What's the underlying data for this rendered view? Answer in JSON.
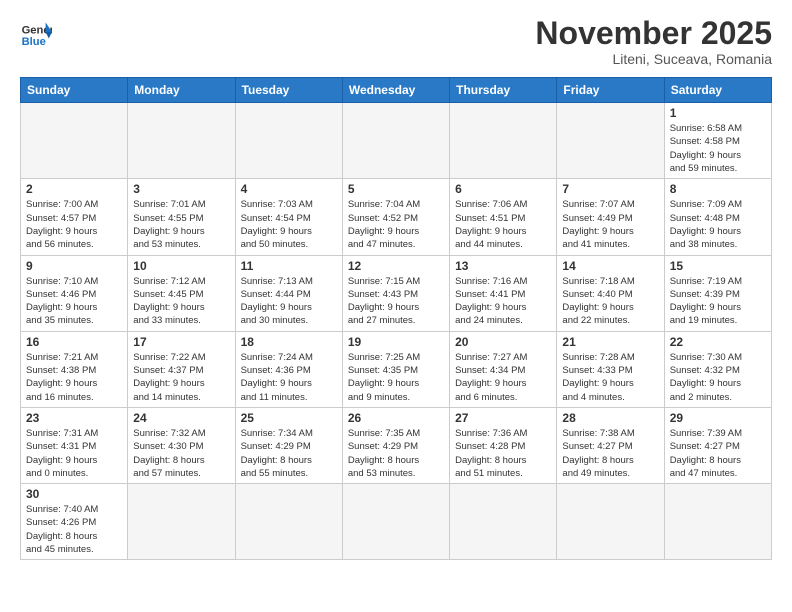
{
  "logo": {
    "text_general": "General",
    "text_blue": "Blue"
  },
  "header": {
    "month_year": "November 2025",
    "location": "Liteni, Suceava, Romania"
  },
  "weekdays": [
    "Sunday",
    "Monday",
    "Tuesday",
    "Wednesday",
    "Thursday",
    "Friday",
    "Saturday"
  ],
  "weeks": [
    [
      {
        "day": "",
        "info": ""
      },
      {
        "day": "",
        "info": ""
      },
      {
        "day": "",
        "info": ""
      },
      {
        "day": "",
        "info": ""
      },
      {
        "day": "",
        "info": ""
      },
      {
        "day": "",
        "info": ""
      },
      {
        "day": "1",
        "info": "Sunrise: 6:58 AM\nSunset: 4:58 PM\nDaylight: 9 hours\nand 59 minutes."
      }
    ],
    [
      {
        "day": "2",
        "info": "Sunrise: 7:00 AM\nSunset: 4:57 PM\nDaylight: 9 hours\nand 56 minutes."
      },
      {
        "day": "3",
        "info": "Sunrise: 7:01 AM\nSunset: 4:55 PM\nDaylight: 9 hours\nand 53 minutes."
      },
      {
        "day": "4",
        "info": "Sunrise: 7:03 AM\nSunset: 4:54 PM\nDaylight: 9 hours\nand 50 minutes."
      },
      {
        "day": "5",
        "info": "Sunrise: 7:04 AM\nSunset: 4:52 PM\nDaylight: 9 hours\nand 47 minutes."
      },
      {
        "day": "6",
        "info": "Sunrise: 7:06 AM\nSunset: 4:51 PM\nDaylight: 9 hours\nand 44 minutes."
      },
      {
        "day": "7",
        "info": "Sunrise: 7:07 AM\nSunset: 4:49 PM\nDaylight: 9 hours\nand 41 minutes."
      },
      {
        "day": "8",
        "info": "Sunrise: 7:09 AM\nSunset: 4:48 PM\nDaylight: 9 hours\nand 38 minutes."
      }
    ],
    [
      {
        "day": "9",
        "info": "Sunrise: 7:10 AM\nSunset: 4:46 PM\nDaylight: 9 hours\nand 35 minutes."
      },
      {
        "day": "10",
        "info": "Sunrise: 7:12 AM\nSunset: 4:45 PM\nDaylight: 9 hours\nand 33 minutes."
      },
      {
        "day": "11",
        "info": "Sunrise: 7:13 AM\nSunset: 4:44 PM\nDaylight: 9 hours\nand 30 minutes."
      },
      {
        "day": "12",
        "info": "Sunrise: 7:15 AM\nSunset: 4:43 PM\nDaylight: 9 hours\nand 27 minutes."
      },
      {
        "day": "13",
        "info": "Sunrise: 7:16 AM\nSunset: 4:41 PM\nDaylight: 9 hours\nand 24 minutes."
      },
      {
        "day": "14",
        "info": "Sunrise: 7:18 AM\nSunset: 4:40 PM\nDaylight: 9 hours\nand 22 minutes."
      },
      {
        "day": "15",
        "info": "Sunrise: 7:19 AM\nSunset: 4:39 PM\nDaylight: 9 hours\nand 19 minutes."
      }
    ],
    [
      {
        "day": "16",
        "info": "Sunrise: 7:21 AM\nSunset: 4:38 PM\nDaylight: 9 hours\nand 16 minutes."
      },
      {
        "day": "17",
        "info": "Sunrise: 7:22 AM\nSunset: 4:37 PM\nDaylight: 9 hours\nand 14 minutes."
      },
      {
        "day": "18",
        "info": "Sunrise: 7:24 AM\nSunset: 4:36 PM\nDaylight: 9 hours\nand 11 minutes."
      },
      {
        "day": "19",
        "info": "Sunrise: 7:25 AM\nSunset: 4:35 PM\nDaylight: 9 hours\nand 9 minutes."
      },
      {
        "day": "20",
        "info": "Sunrise: 7:27 AM\nSunset: 4:34 PM\nDaylight: 9 hours\nand 6 minutes."
      },
      {
        "day": "21",
        "info": "Sunrise: 7:28 AM\nSunset: 4:33 PM\nDaylight: 9 hours\nand 4 minutes."
      },
      {
        "day": "22",
        "info": "Sunrise: 7:30 AM\nSunset: 4:32 PM\nDaylight: 9 hours\nand 2 minutes."
      }
    ],
    [
      {
        "day": "23",
        "info": "Sunrise: 7:31 AM\nSunset: 4:31 PM\nDaylight: 9 hours\nand 0 minutes."
      },
      {
        "day": "24",
        "info": "Sunrise: 7:32 AM\nSunset: 4:30 PM\nDaylight: 8 hours\nand 57 minutes."
      },
      {
        "day": "25",
        "info": "Sunrise: 7:34 AM\nSunset: 4:29 PM\nDaylight: 8 hours\nand 55 minutes."
      },
      {
        "day": "26",
        "info": "Sunrise: 7:35 AM\nSunset: 4:29 PM\nDaylight: 8 hours\nand 53 minutes."
      },
      {
        "day": "27",
        "info": "Sunrise: 7:36 AM\nSunset: 4:28 PM\nDaylight: 8 hours\nand 51 minutes."
      },
      {
        "day": "28",
        "info": "Sunrise: 7:38 AM\nSunset: 4:27 PM\nDaylight: 8 hours\nand 49 minutes."
      },
      {
        "day": "29",
        "info": "Sunrise: 7:39 AM\nSunset: 4:27 PM\nDaylight: 8 hours\nand 47 minutes."
      }
    ],
    [
      {
        "day": "30",
        "info": "Sunrise: 7:40 AM\nSunset: 4:26 PM\nDaylight: 8 hours\nand 45 minutes."
      },
      {
        "day": "",
        "info": ""
      },
      {
        "day": "",
        "info": ""
      },
      {
        "day": "",
        "info": ""
      },
      {
        "day": "",
        "info": ""
      },
      {
        "day": "",
        "info": ""
      },
      {
        "day": "",
        "info": ""
      }
    ]
  ]
}
